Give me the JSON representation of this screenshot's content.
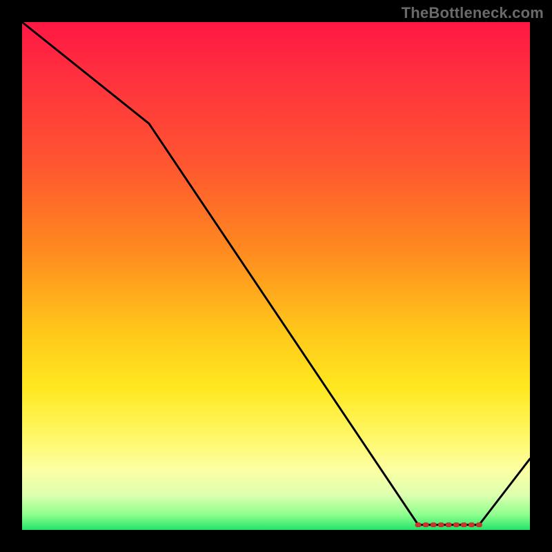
{
  "watermark": "TheBottleneck.com",
  "colors": {
    "line": "#000000",
    "marker_fill": "#c9342b",
    "marker_stroke": "#bf2d24"
  },
  "chart_data": {
    "type": "line",
    "title": "",
    "xlabel": "",
    "ylabel": "",
    "xlim": [
      0,
      100
    ],
    "ylim": [
      0,
      100
    ],
    "series": [
      {
        "name": "curve",
        "x": [
          0,
          25,
          78,
          90,
          100
        ],
        "y": [
          100,
          80,
          1,
          1,
          14
        ]
      }
    ],
    "flat_segment": {
      "x_start": 78,
      "x_end": 90,
      "y": 1,
      "marker_count": 9
    },
    "notes": "Values estimated from pixel positions; y=100 at top of plot, y=0 at bottom. The line descends steeply from top-left, has a moderate slope change ~x=25, becomes nearly flat with small red markers along the trough (~x 78–90 at y≈1), then rises toward the right edge (y≈14 at x=100)."
  }
}
